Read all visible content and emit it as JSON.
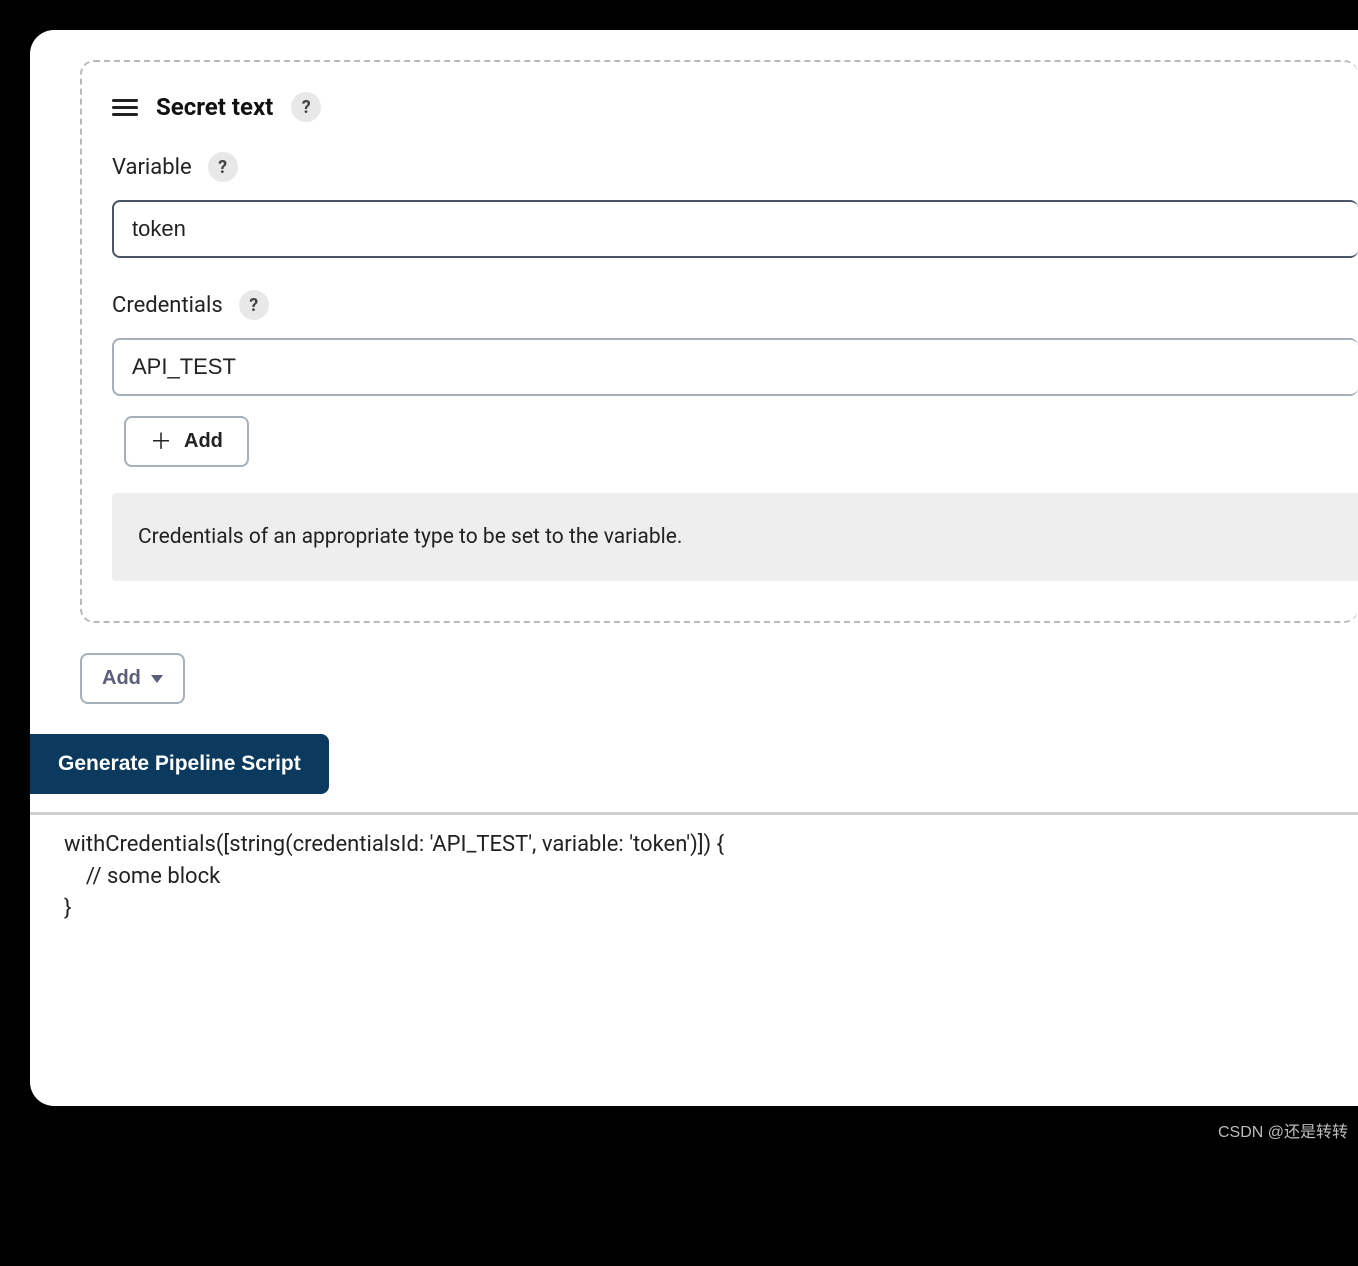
{
  "section": {
    "title": "Secret text"
  },
  "fields": {
    "variable": {
      "label": "Variable",
      "value": "token"
    },
    "credentials": {
      "label": "Credentials",
      "value": "API_TEST",
      "add_button": "Add",
      "help_text": "Credentials of an appropriate type to be set to the variable."
    }
  },
  "bindings": {
    "add_button": "Add"
  },
  "generate_button": "Generate Pipeline Script",
  "script_output": "withCredentials([string(credentialsId: 'API_TEST', variable: 'token')]) {\n    // some block\n}",
  "watermark": "CSDN @还是转转"
}
